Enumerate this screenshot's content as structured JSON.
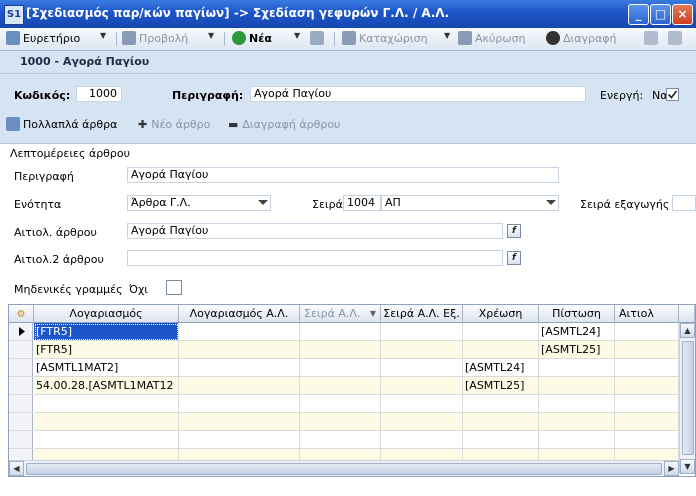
{
  "window": {
    "app_icon": "S1",
    "title": "[Σχεδιασμός παρ/κών παγίων] -> Σχεδίαση γεφυρών Γ.Λ. / Α.Λ.",
    "minimize": "_",
    "maximize": "□",
    "close": "×"
  },
  "toolbar": {
    "index_label": "Ευρετήριο",
    "view_label": "Προβολή",
    "new_label": "Νέα",
    "save_label": "Καταχώριση",
    "cancel_label": "Ακύρωση",
    "delete_label": "Διαγραφή"
  },
  "record_header": "1000 - Αγορά Παγίου",
  "form": {
    "code_label": "Κωδικός:",
    "code_value": "1000",
    "description_label": "Περιγραφή:",
    "description_value": "Αγορά Παγίου",
    "active_label": "Ενεργή:",
    "active_value": "Ναι"
  },
  "subtoolbar": {
    "multi_lines": "Πολλαπλά άρθρα",
    "new_line": "Νέο άρθρο",
    "delete_line": "Διαγραφή άρθρου"
  },
  "details": {
    "group_title": "Λεπτομέρειες άρθρου",
    "desc_label": "Περιγραφή",
    "desc_value": "Αγορά Παγίου",
    "unit_label": "Ενότητα",
    "unit_value": "Άρθρα Γ.Λ.",
    "series_label": "Σειρά",
    "series_code": "1004",
    "series_value": "ΑΠ",
    "export_series_label": "Σειρά εξαγωγής",
    "entry_label": "Αιτιολ. άρθρου",
    "entry_value": "Αγορά Παγίου",
    "entry2_label": "Αιτιολ.2 άρθρου",
    "entry2_value": "",
    "zero_lines_label": "Μηδενικές γραμμές",
    "zero_lines_value": "Όχι",
    "fx_label": "f"
  },
  "grid": {
    "columns": [
      "Λογαριασμός",
      "Λογαριασμός Α.Λ.",
      "Σειρά Α.Λ.",
      "Σειρά Α.Λ. Εξ.",
      "Χρέωση",
      "Πίστωση",
      "Αιτιολ"
    ],
    "rows": [
      [
        "[FTR5]",
        "",
        "",
        "",
        "",
        "[ASMTL24]",
        ""
      ],
      [
        "[FTR5]",
        "",
        "",
        "",
        "",
        "[ASMTL25]",
        ""
      ],
      [
        "[ASMTL1MAT2]",
        "",
        "",
        "",
        "[ASMTL24]",
        "",
        ""
      ],
      [
        "54.00.28.[ASMTL1MAT12",
        "",
        "",
        "",
        "[ASMTL25]",
        "",
        ""
      ],
      [
        "",
        "",
        "",
        "",
        "",
        "",
        ""
      ],
      [
        "",
        "",
        "",
        "",
        "",
        "",
        ""
      ],
      [
        "",
        "",
        "",
        "",
        "",
        "",
        ""
      ],
      [
        "",
        "",
        "",
        "",
        "",
        "",
        ""
      ]
    ]
  },
  "colors": {
    "title_bar": "#1c55c8",
    "row_alt": "#fdfbe6",
    "selected_cell": "#1c55c8"
  }
}
